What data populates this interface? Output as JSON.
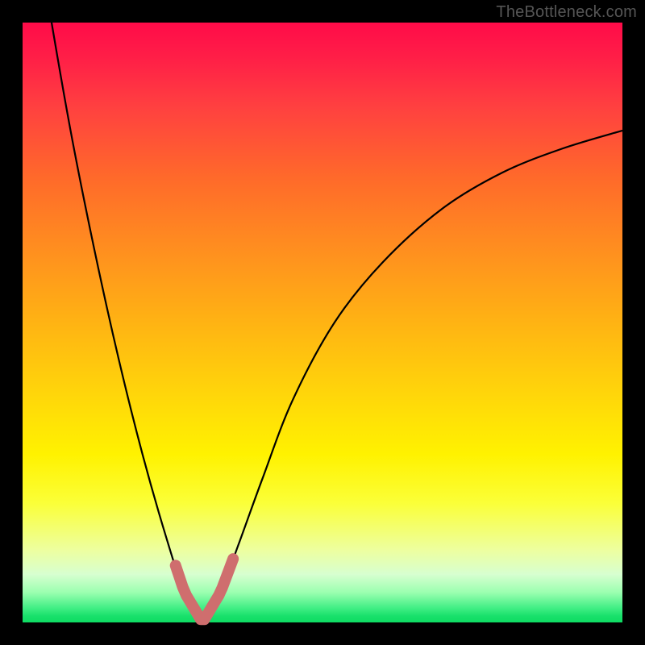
{
  "attribution": "TheBottleneck.com",
  "colors": {
    "curve_stroke": "#000000",
    "highlight_stroke": "#cf6e6e",
    "gradient_top": "#ff0b49",
    "gradient_bottom": "#0fdc63",
    "frame": "#000000"
  },
  "chart_data": {
    "type": "line",
    "title": "",
    "xlabel": "",
    "ylabel": "",
    "xlim": [
      0,
      1
    ],
    "ylim": [
      0,
      1
    ],
    "notes": "Bottleneck-style V curve. x is a normalized component ratio; y is normalized bottleneck percentage (0 at balanced point, rising toward 1 at extremes). Minimum (optimal balance) at x ≈ 0.30. Pink highlight marks the near-zero-bottleneck region. Background gradient encodes severity: green≈0, yellow≈0.25, red≈1.",
    "series": [
      {
        "name": "bottleneck-curve",
        "x": [
          0.0,
          0.04,
          0.08,
          0.12,
          0.16,
          0.2,
          0.24,
          0.27,
          0.3,
          0.33,
          0.36,
          0.4,
          0.45,
          0.52,
          0.6,
          0.7,
          0.8,
          0.9,
          1.0
        ],
        "y": [
          1.3,
          1.05,
          0.82,
          0.62,
          0.44,
          0.28,
          0.14,
          0.05,
          0.0,
          0.05,
          0.13,
          0.24,
          0.37,
          0.5,
          0.6,
          0.69,
          0.75,
          0.79,
          0.82
        ]
      }
    ],
    "highlight_region": {
      "x_start": 0.255,
      "x_end": 0.355
    },
    "gradient_stops": [
      {
        "pos": 0.0,
        "color": "#ff0b49"
      },
      {
        "pos": 0.5,
        "color": "#ffd60a"
      },
      {
        "pos": 0.8,
        "color": "#fbff37"
      },
      {
        "pos": 1.0,
        "color": "#0fdc63"
      }
    ]
  }
}
